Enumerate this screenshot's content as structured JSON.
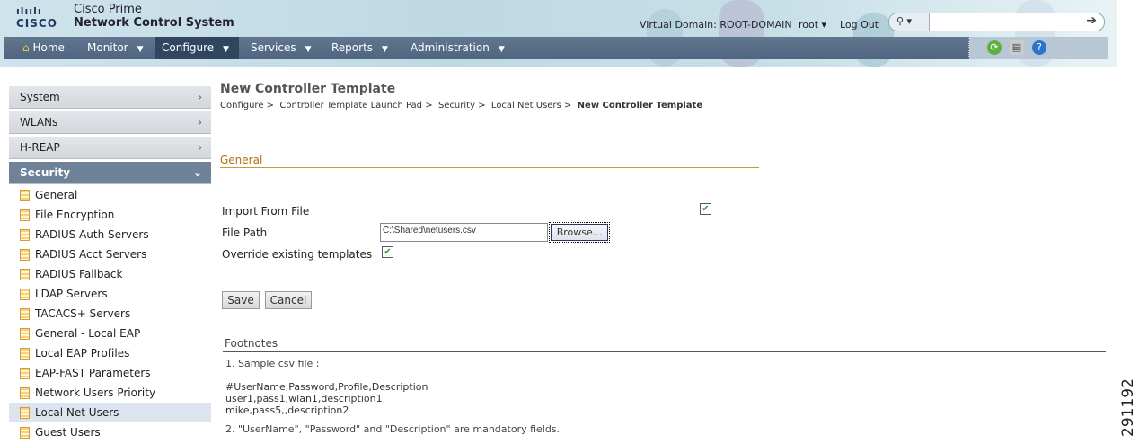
{
  "header": {
    "logo_bars": "ılıılı",
    "logo_word": "CISCO",
    "product_line1": "Cisco Prime",
    "product_line2": "Network Control System",
    "virtual_domain": "Virtual Domain: ROOT-DOMAIN",
    "user": "root ▾",
    "logout": "Log Out",
    "search_placeholder": "",
    "search_scope": "⚲ ▾",
    "go": "➔"
  },
  "nav": {
    "items": [
      {
        "label": "Home"
      },
      {
        "label": "Monitor"
      },
      {
        "label": "Configure"
      },
      {
        "label": "Services"
      },
      {
        "label": "Reports"
      },
      {
        "label": "Administration"
      }
    ],
    "caret": "▼",
    "active": "Configure"
  },
  "sidebar": {
    "categories": [
      {
        "label": "System"
      },
      {
        "label": "WLANs"
      },
      {
        "label": "H-REAP"
      },
      {
        "label": "Security"
      }
    ],
    "security_items": [
      "General",
      " File Encryption",
      "RADIUS Auth Servers",
      "RADIUS Acct Servers",
      "RADIUS Fallback",
      "LDAP Servers",
      "TACACS+ Servers",
      "General - Local EAP",
      "Local EAP Profiles",
      "EAP-FAST Parameters",
      "Network Users Priority",
      "Local Net Users",
      "Guest Users"
    ],
    "selected": "Local Net Users"
  },
  "main": {
    "title": "New Controller Template",
    "breadcrumb": [
      "Configure >",
      "Controller Template Launch Pad >",
      "Security >",
      "Local Net Users >",
      "New Controller Template"
    ],
    "section": "General",
    "import_label": "Import From File",
    "import_checked": true,
    "file_path_label": "File Path",
    "file_path_value": "C:\\Shared\\netusers.csv",
    "browse": "Browse...",
    "override_label": "Override existing templates",
    "override_checked": true,
    "save": "Save",
    "cancel": "Cancel",
    "footnotes_title": "Footnotes",
    "footnote1": "1. Sample csv file :",
    "csv_lines": [
      "#UserName,Password,Profile,Description",
      "user1,pass1,wlan1,description1",
      "mike,pass5,,description2"
    ],
    "footnote2": "2. \"UserName\", \"Password\" and \"Description\" are mandatory fields."
  },
  "figure_number": "291192",
  "check_glyph": "✔"
}
